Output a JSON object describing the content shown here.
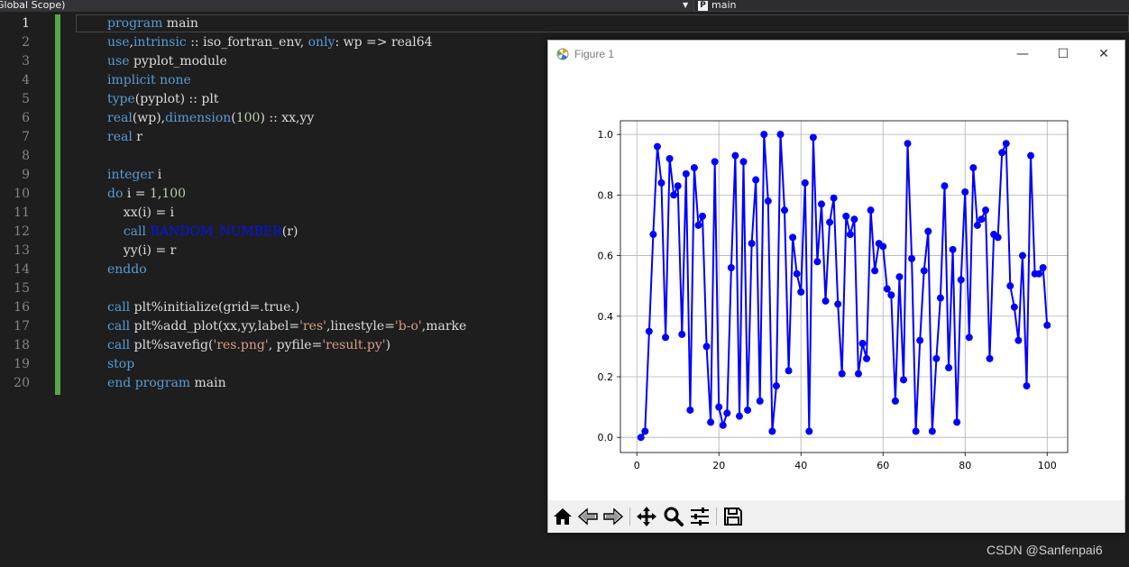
{
  "scope": {
    "left_label": "Global Scope)",
    "right_label": "main"
  },
  "editor": {
    "line_numbers": [
      "1",
      "2",
      "3",
      "4",
      "5",
      "6",
      "7",
      "8",
      "9",
      "10",
      "11",
      "12",
      "13",
      "14",
      "15",
      "16",
      "17",
      "18",
      "19",
      "20"
    ]
  },
  "figure": {
    "title": "Figure 1",
    "buttons": {
      "minimize": "—",
      "maximize": "☐",
      "close": "✕"
    }
  },
  "toolbar": {
    "icons": [
      "home-icon",
      "back-icon",
      "forward-icon",
      "pan-icon",
      "zoom-icon",
      "configure-icon",
      "save-icon"
    ]
  },
  "chart_data": {
    "type": "line",
    "marker": "o",
    "color": "#0000ff",
    "grid": true,
    "xlim": [
      -4,
      105
    ],
    "ylim": [
      -0.05,
      1.045
    ],
    "xticks": [
      "0",
      "20",
      "40",
      "60",
      "80",
      "100"
    ],
    "yticks": [
      "0.0",
      "0.2",
      "0.4",
      "0.6",
      "0.8",
      "1.0"
    ],
    "x": [
      1,
      2,
      3,
      4,
      5,
      6,
      7,
      8,
      9,
      10,
      11,
      12,
      13,
      14,
      15,
      16,
      17,
      18,
      19,
      20,
      21,
      22,
      23,
      24,
      25,
      26,
      27,
      28,
      29,
      30,
      31,
      32,
      33,
      34,
      35,
      36,
      37,
      38,
      39,
      40,
      41,
      42,
      43,
      44,
      45,
      46,
      47,
      48,
      49,
      50,
      51,
      52,
      53,
      54,
      55,
      56,
      57,
      58,
      59,
      60,
      61,
      62,
      63,
      64,
      65,
      66,
      67,
      68,
      69,
      70,
      71,
      72,
      73,
      74,
      75,
      76,
      77,
      78,
      79,
      80,
      81,
      82,
      83,
      84,
      85,
      86,
      87,
      88,
      89,
      90,
      91,
      92,
      93,
      94,
      95,
      96,
      97,
      98,
      99,
      100
    ],
    "y": [
      0.0,
      0.02,
      0.35,
      0.67,
      0.96,
      0.84,
      0.33,
      0.92,
      0.8,
      0.83,
      0.34,
      0.87,
      0.09,
      0.89,
      0.7,
      0.73,
      0.3,
      0.05,
      0.91,
      0.1,
      0.04,
      0.08,
      0.56,
      0.93,
      0.07,
      0.91,
      0.09,
      0.64,
      0.85,
      0.12,
      1.0,
      0.78,
      0.02,
      0.17,
      1.0,
      0.75,
      0.22,
      0.66,
      0.54,
      0.48,
      0.84,
      0.02,
      0.99,
      0.58,
      0.77,
      0.45,
      0.71,
      0.79,
      0.44,
      0.21,
      0.73,
      0.67,
      0.72,
      0.21,
      0.31,
      0.26,
      0.75,
      0.55,
      0.64,
      0.63,
      0.49,
      0.47,
      0.12,
      0.53,
      0.19,
      0.97,
      0.59,
      0.02,
      0.32,
      0.55,
      0.68,
      0.02,
      0.26,
      0.46,
      0.83,
      0.23,
      0.62,
      0.05,
      0.52,
      0.81,
      0.33,
      0.89,
      0.7,
      0.72,
      0.75,
      0.26,
      0.67,
      0.66,
      0.94,
      0.97,
      0.5,
      0.43,
      0.32,
      0.6,
      0.17,
      0.93,
      0.54,
      0.54,
      0.56,
      0.37
    ]
  },
  "watermark": "CSDN @Sanfenpai6"
}
